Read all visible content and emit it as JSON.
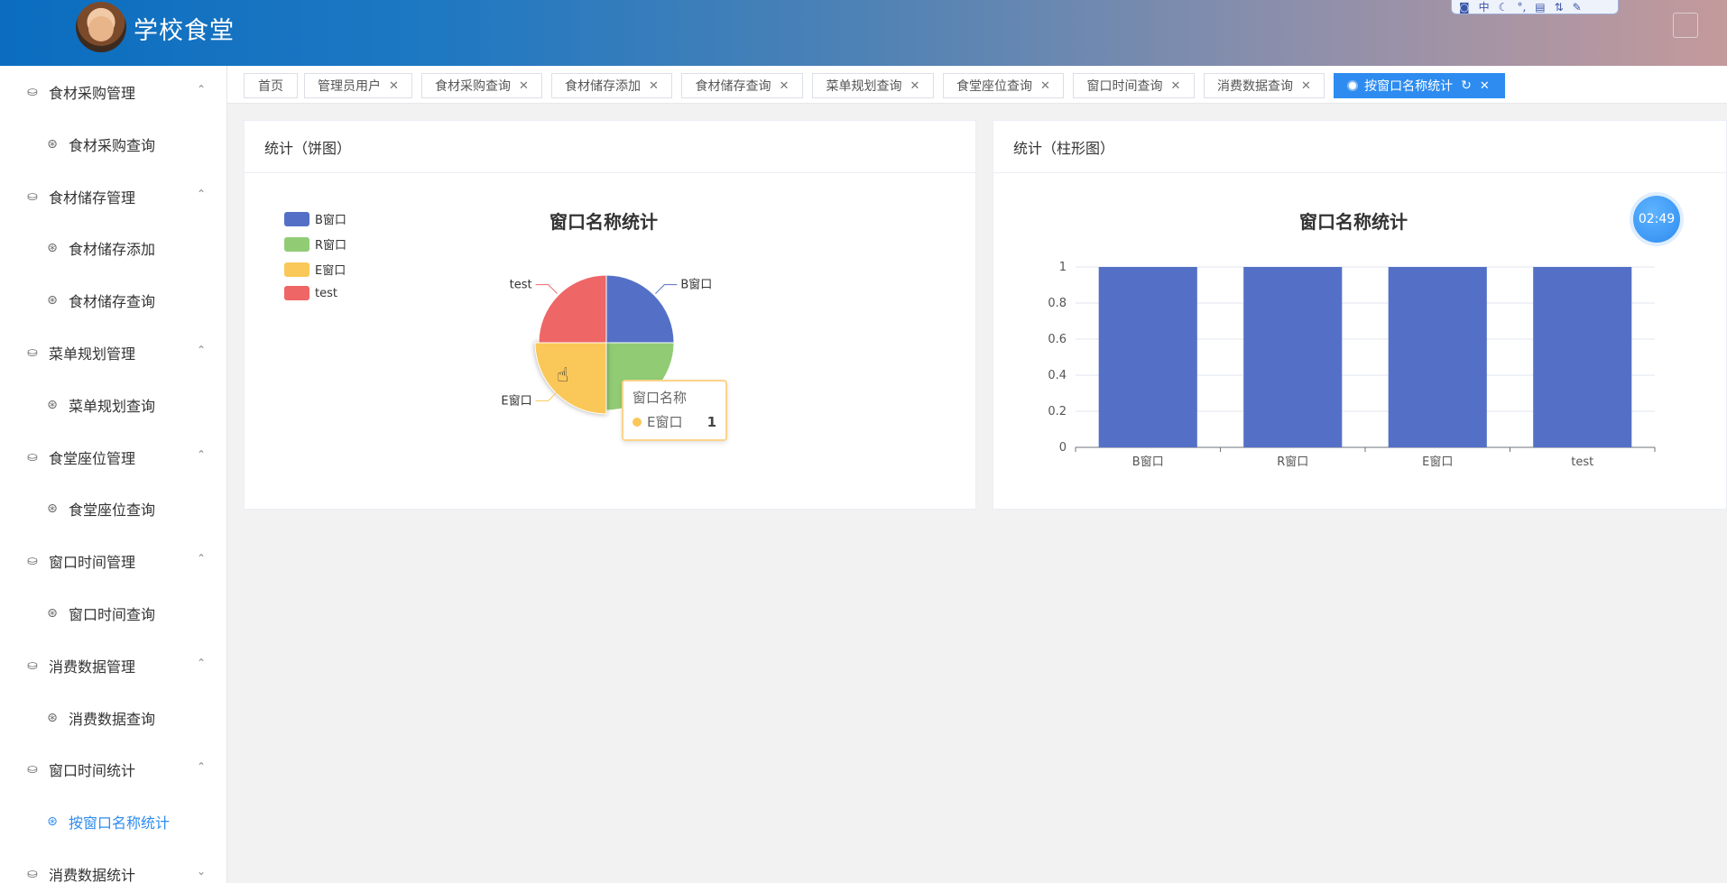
{
  "app": {
    "title": "学校食堂"
  },
  "sidebar": {
    "items": [
      {
        "type": "group",
        "label": "食材采购管理"
      },
      {
        "type": "sub",
        "label": "食材采购查询"
      },
      {
        "type": "group",
        "label": "食材储存管理"
      },
      {
        "type": "sub",
        "label": "食材储存添加"
      },
      {
        "type": "sub",
        "label": "食材储存查询"
      },
      {
        "type": "group",
        "label": "菜单规划管理"
      },
      {
        "type": "sub",
        "label": "菜单规划查询"
      },
      {
        "type": "group",
        "label": "食堂座位管理"
      },
      {
        "type": "sub",
        "label": "食堂座位查询"
      },
      {
        "type": "group",
        "label": "窗口时间管理"
      },
      {
        "type": "sub",
        "label": "窗口时间查询"
      },
      {
        "type": "group",
        "label": "消费数据管理"
      },
      {
        "type": "sub",
        "label": "消费数据查询"
      },
      {
        "type": "group",
        "label": "窗口时间统计"
      },
      {
        "type": "sub",
        "label": "按窗口名称统计",
        "active": true
      },
      {
        "type": "group",
        "label": "消费数据统计",
        "collapsed": true
      }
    ]
  },
  "tabs": [
    {
      "label": "首页"
    },
    {
      "label": "管理员用户"
    },
    {
      "label": "食材采购查询"
    },
    {
      "label": "食材储存添加"
    },
    {
      "label": "食材储存查询"
    },
    {
      "label": "菜单规划查询"
    },
    {
      "label": "食堂座位查询"
    },
    {
      "label": "窗口时间查询"
    },
    {
      "label": "消费数据查询"
    },
    {
      "label": "按窗口名称统计",
      "active": true
    }
  ],
  "pie_card": {
    "header": "统计（饼图）"
  },
  "bar_card": {
    "header": "统计（柱形图）"
  },
  "tooltip": {
    "title": "窗口名称",
    "label": "E窗口",
    "value": "1"
  },
  "timer": {
    "text": "02:49"
  },
  "colors": {
    "blue": "#5470c6",
    "green": "#91cc75",
    "yellow": "#fac858",
    "red": "#ee6666",
    "accent": "#2e8cf0"
  },
  "chart_data": [
    {
      "type": "pie",
      "title": "窗口名称统计",
      "categories": [
        "B窗口",
        "R窗口",
        "E窗口",
        "test"
      ],
      "values": [
        1,
        1,
        1,
        1
      ],
      "legend": [
        "B窗口",
        "R窗口",
        "E窗口",
        "test"
      ],
      "legend_position": "top-left",
      "highlighted": "E窗口"
    },
    {
      "type": "bar",
      "title": "窗口名称统计",
      "categories": [
        "B窗口",
        "R窗口",
        "E窗口",
        "test"
      ],
      "values": [
        1,
        1,
        1,
        1
      ],
      "ylim": [
        0,
        1
      ],
      "yticks": [
        "0",
        "0.2",
        "0.4",
        "0.6",
        "0.8",
        "1"
      ],
      "grid": true
    }
  ]
}
